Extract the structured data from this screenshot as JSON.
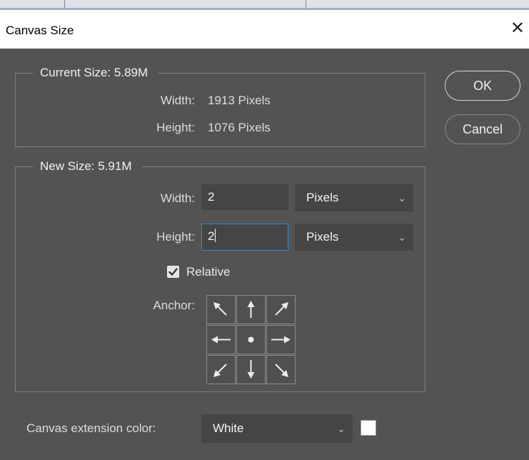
{
  "dialog": {
    "title": "Canvas Size",
    "close_glyph": "✕"
  },
  "current_size": {
    "legend": "Current Size: 5.89M",
    "width_label": "Width:",
    "width_value": "1913 Pixels",
    "height_label": "Height:",
    "height_value": "1076 Pixels"
  },
  "new_size": {
    "legend": "New Size: 5.91M",
    "width_label": "Width:",
    "width_value": "2",
    "width_unit": "Pixels",
    "height_label": "Height:",
    "height_value": "2",
    "height_unit": "Pixels",
    "relative_label": "Relative",
    "relative_checked": true,
    "anchor_label": "Anchor:"
  },
  "anchor": {
    "arrows": [
      "↖",
      "↑",
      "↗",
      "←",
      "•",
      "→",
      "↙",
      "↓",
      "↘"
    ]
  },
  "buttons": {
    "ok": "OK",
    "cancel": "Cancel"
  },
  "extension": {
    "label": "Canvas extension color:",
    "value": "White",
    "swatch_color": "#ffffff"
  },
  "colors": {
    "dialog_bg": "#535353",
    "field_bg": "#454545",
    "focus_border": "#2e8dd9"
  }
}
